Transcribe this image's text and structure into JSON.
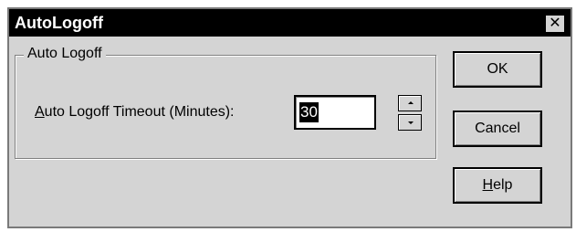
{
  "window": {
    "title": "AutoLogoff",
    "close_glyph": "✕"
  },
  "group": {
    "label": "Auto Logoff"
  },
  "field": {
    "label_first_char": "A",
    "label_rest": "uto Logoff Timeout (Minutes):",
    "value": "30"
  },
  "buttons": {
    "ok": "OK",
    "cancel": "Cancel",
    "help_first_char": "H",
    "help_rest": "elp"
  },
  "icons": {
    "close": "close-icon",
    "spin_up": "chevron-up-icon",
    "spin_down": "chevron-down-icon"
  }
}
